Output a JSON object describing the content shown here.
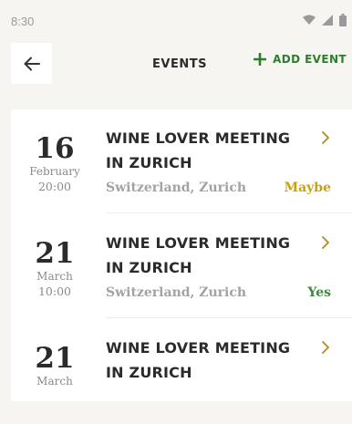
{
  "status_bar": {
    "time": "8:30",
    "icons": [
      "wifi-icon",
      "cellular-signal-icon",
      "battery-icon"
    ]
  },
  "header": {
    "back_icon": "arrow-left-icon",
    "title": "EVENTS",
    "add_icon": "plus-icon",
    "add_label": "ADD EVENT"
  },
  "colors": {
    "accent_green": "#2e7d2e",
    "maybe": "#c9a010",
    "yes": "#3a8a3a",
    "background": "#f7f5f2"
  },
  "events": [
    {
      "day": "16",
      "month": "February",
      "time": "20:00",
      "title_line1": "WINE LOVER MEETING",
      "title_line2": "IN ZURICH",
      "location": "Switzerland, Zurich",
      "status": "Maybe"
    },
    {
      "day": "21",
      "month": "March",
      "time": "10:00",
      "title_line1": "WINE LOVER MEETING",
      "title_line2": "IN ZURICH",
      "location": "Switzerland, Zurich",
      "status": "Yes"
    },
    {
      "day": "21",
      "month": "March",
      "title_line1": "WINE LOVER MEETING",
      "title_line2": "IN ZURICH"
    }
  ]
}
